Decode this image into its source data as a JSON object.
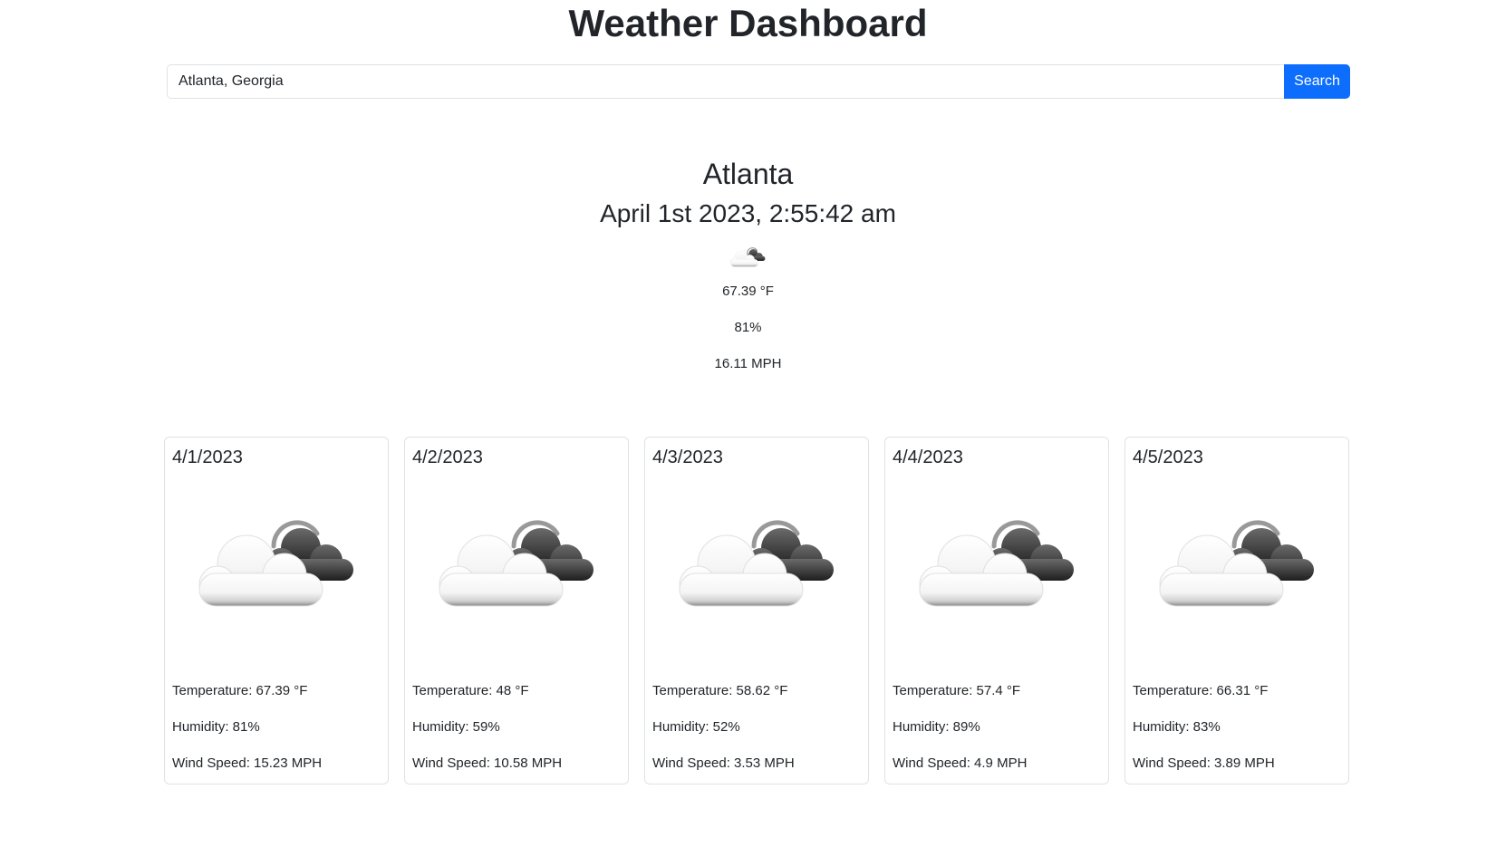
{
  "header": {
    "title": "Weather Dashboard"
  },
  "search": {
    "value": "Atlanta, Georgia",
    "button_label": "Search"
  },
  "current": {
    "city": "Atlanta",
    "datetime": "April 1st 2023, 2:55:42 am",
    "icon": "partly-cloudy-night-icon",
    "temperature": "67.39 °F",
    "humidity": "81%",
    "wind": "16.11 MPH"
  },
  "forecast": [
    {
      "date": "4/1/2023",
      "icon": "partly-cloudy-night-icon",
      "temperature": "Temperature: 67.39 °F",
      "humidity": "Humidity: 81%",
      "wind": "Wind Speed: 15.23 MPH"
    },
    {
      "date": "4/2/2023",
      "icon": "partly-cloudy-night-icon",
      "temperature": "Temperature: 48 °F",
      "humidity": "Humidity: 59%",
      "wind": "Wind Speed: 10.58 MPH"
    },
    {
      "date": "4/3/2023",
      "icon": "partly-cloudy-night-icon",
      "temperature": "Temperature: 58.62 °F",
      "humidity": "Humidity: 52%",
      "wind": "Wind Speed: 3.53 MPH"
    },
    {
      "date": "4/4/2023",
      "icon": "partly-cloudy-night-icon",
      "temperature": "Temperature: 57.4 °F",
      "humidity": "Humidity: 89%",
      "wind": "Wind Speed: 4.9 MPH"
    },
    {
      "date": "4/5/2023",
      "icon": "partly-cloudy-night-icon",
      "temperature": "Temperature: 66.31 °F",
      "humidity": "Humidity: 83%",
      "wind": "Wind Speed: 3.89 MPH"
    }
  ],
  "colors": {
    "accent": "#0d6efd",
    "text": "#212529",
    "border": "#dee2e6"
  }
}
